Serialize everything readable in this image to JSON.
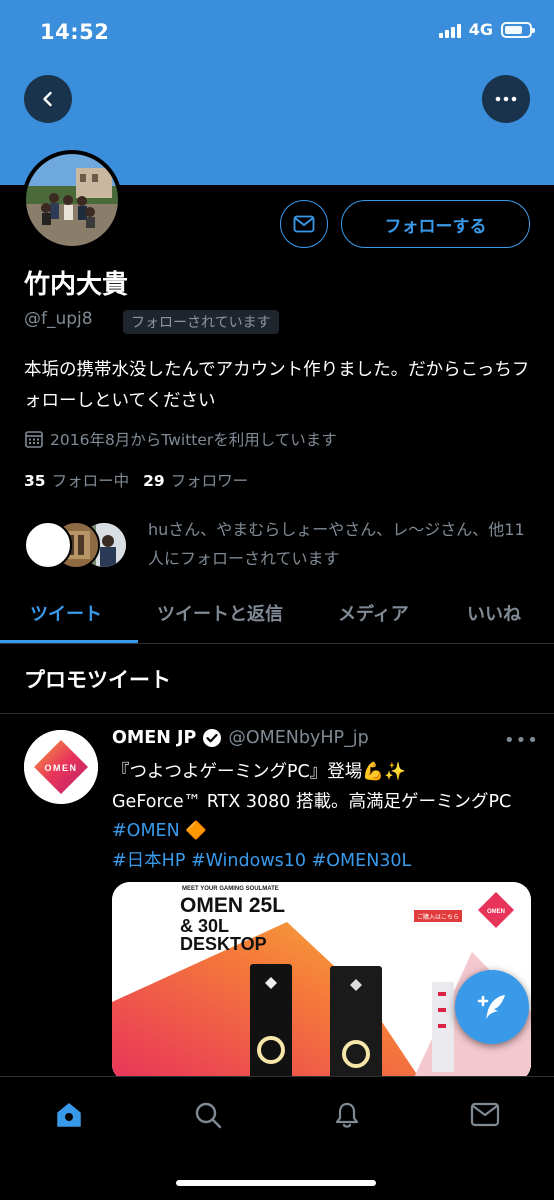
{
  "status_bar": {
    "time": "14:52",
    "network": "4G",
    "battery_level": 0.75
  },
  "profile": {
    "display_name": "竹内大貴",
    "handle": "@f_upj8",
    "follows_you": "フォローされています",
    "follow_button": "フォローする",
    "bio": "本垢の携帯水没したんでアカウント作りました。だからこっちフォローしといてください",
    "joined": "2016年8月からTwitterを利用しています",
    "following_count": "35",
    "following_label": "フォロー中",
    "followers_count": "29",
    "followers_label": "フォロワー",
    "known_followers": "huさん、やまむらしょーやさん、レ〜ジさん、他11人にフォローされています"
  },
  "tabs": [
    "ツイート",
    "ツイートと返信",
    "メディア",
    "いいね"
  ],
  "section_title": "プロモツイート",
  "tweet": {
    "name": "OMEN JP",
    "handle": "@OMENbyHP_jp",
    "text_line1": "『つよつよゲーミングPC』登場💪✨",
    "text_line2": "GeForce™ RTX 3080 搭載。高満足ゲーミングPC ",
    "tag_omen": "#OMEN",
    "tag_emoji": "🔶",
    "tag_hp": "#日本HP",
    "tag_win": "#Windows10",
    "tag_omen30l": "#OMEN30L",
    "avatar_logo": "OMEN",
    "media": {
      "small_caption": "MEET YOUR GAMING SOULMATE",
      "headline_1": "OMEN 25L",
      "headline_2": "& 30L",
      "headline_3": "DESKTOP",
      "badge": "ご購入はこちら",
      "logo": "OMEN"
    }
  },
  "colors": {
    "accent": "#3a9aea",
    "banner": "#3a8edb",
    "background": "#000000",
    "muted": "#7f8a95"
  }
}
